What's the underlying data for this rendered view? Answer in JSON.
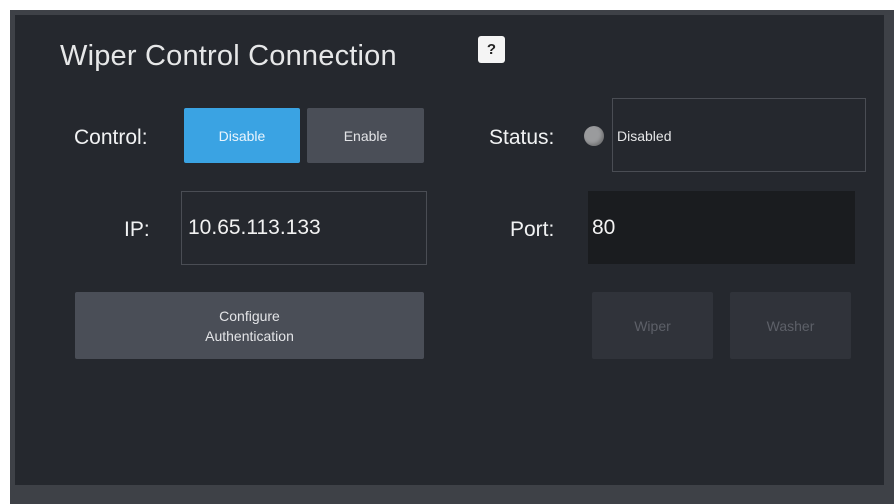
{
  "panel": {
    "title": "Wiper Control Connection",
    "help_label": "?"
  },
  "control": {
    "label": "Control:",
    "disable_label": "Disable",
    "enable_label": "Enable",
    "selected": "Disable"
  },
  "status": {
    "label": "Status:",
    "value": "Disabled",
    "indicator_color": "#9a9b9d"
  },
  "ip": {
    "label": "IP:",
    "value": "10.65.113.133"
  },
  "port": {
    "label": "Port:",
    "value": "80"
  },
  "actions": {
    "configure_line1": "Configure",
    "configure_line2": "Authentication",
    "wiper_label": "Wiper",
    "washer_label": "Washer"
  },
  "colors": {
    "accent": "#3aa3e3",
    "panel_bg": "#25282e",
    "button_bg": "#4a4e57"
  }
}
